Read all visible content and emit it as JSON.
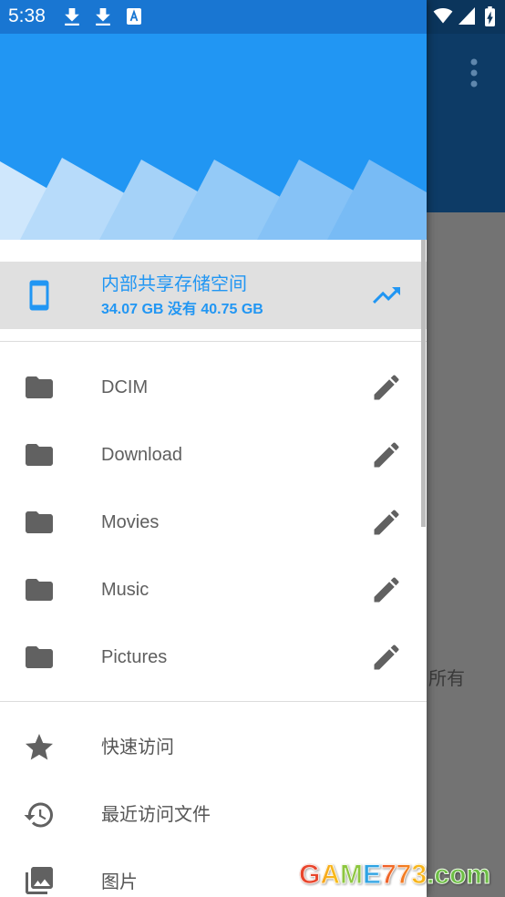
{
  "status_bar": {
    "time": "5:38",
    "notification_icons": [
      "download-icon",
      "download-icon",
      "app-notification-icon"
    ],
    "system_icons": [
      "wifi-icon",
      "signal-icon",
      "battery-charging-icon"
    ]
  },
  "drawer": {
    "storage": {
      "icon": "smartphone-icon",
      "title": "内部共享存储空间",
      "subtitle": "34.07 GB 没有 40.75 GB",
      "action_icon": "trending-up-icon",
      "selected": true
    },
    "folders": [
      {
        "label": "DCIM",
        "icon": "folder-icon",
        "action_icon": "edit-icon"
      },
      {
        "label": "Download",
        "icon": "folder-icon",
        "action_icon": "edit-icon"
      },
      {
        "label": "Movies",
        "icon": "folder-icon",
        "action_icon": "edit-icon"
      },
      {
        "label": "Music",
        "icon": "folder-icon",
        "action_icon": "edit-icon"
      },
      {
        "label": "Pictures",
        "icon": "folder-icon",
        "action_icon": "edit-icon"
      }
    ],
    "shortcuts": [
      {
        "label": "快速访问",
        "icon": "star-icon"
      },
      {
        "label": "最近访问文件",
        "icon": "history-icon"
      },
      {
        "label": "图片",
        "icon": "photo-library-icon"
      }
    ]
  },
  "background_app": {
    "overflow_icon": "more-vert-icon",
    "visible_text": "所有"
  },
  "watermark": "GAME773.com",
  "colors": {
    "status_bar": "#1976D2",
    "header": "#2196F3",
    "accent": "#2196F3",
    "selected_row": "#E0E0E0",
    "text": "#5F5F5F",
    "icon": "#616161",
    "scrim_toolbar": "#0D3B66",
    "scrim_body": "#737373"
  }
}
